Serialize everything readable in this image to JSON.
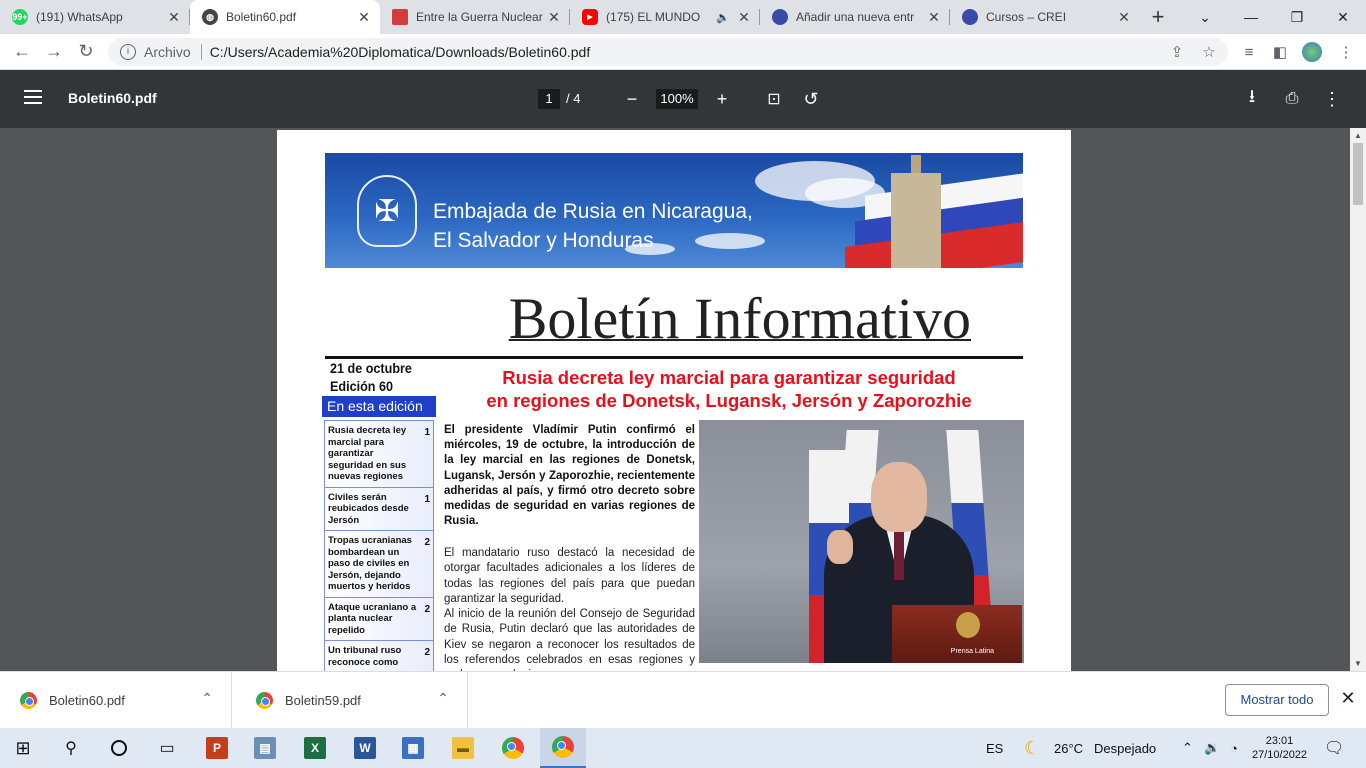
{
  "tabs": [
    {
      "title": "(191) WhatsApp",
      "icon": "whatsapp-icon",
      "icon_color": "#25d366",
      "badge": "99+"
    },
    {
      "title": "Boletin60.pdf",
      "icon": "globe-icon",
      "icon_color": "#444444",
      "active": true
    },
    {
      "title": "Entre la Guerra Nuclear",
      "icon": "site-icon",
      "icon_color": "#d23c3c"
    },
    {
      "title": "(175) EL MUNDO",
      "icon": "youtube-icon",
      "icon_color": "#ff0000"
    },
    {
      "title": "Añadir una nueva entr",
      "icon": "site-icon",
      "icon_color": "#3a4aa8"
    },
    {
      "title": "Cursos – CREI",
      "icon": "site-icon",
      "icon_color": "#3a4aa8"
    }
  ],
  "address": {
    "label": "Archivo",
    "url": "C:/Users/Academia%20Diplomatica/Downloads/Boletin60.pdf"
  },
  "pdf_toolbar": {
    "filename": "Boletin60.pdf",
    "page": "1",
    "page_total": "/ 4",
    "zoom": "100%"
  },
  "pdf": {
    "banner_line1": "Embajada de Rusia en Nicaragua,",
    "banner_line2": "El Salvador y Honduras",
    "title": "Boletín Informativo",
    "date": "21 de octubre",
    "edition": "Edición 60",
    "in_edition": "En esta edición",
    "toc": [
      {
        "text": "Rusia decreta ley marcial para garantizar seguridad en sus nuevas regiones",
        "page": "1"
      },
      {
        "text": "Civiles serán reubicados desde Jersón",
        "page": "1"
      },
      {
        "text": "Tropas ucranianas bombardean un paso de civiles en Jersón, dejando muertos y heridos",
        "page": "2"
      },
      {
        "text": "Ataque ucraniano a planta nuclear repelido",
        "page": "2"
      },
      {
        "text": "Un tribunal ruso reconoce como",
        "page": "2"
      }
    ],
    "headline_line1": "Rusia decreta ley marcial para garantizar seguridad",
    "headline_line2": "en regiones de Donetsk, Lugansk, Jersón y Zaporozhie",
    "lead": "El presidente Vladímir Putin confirmó el miércoles, 19 de octubre, la introducción de la ley marcial en las regiones de Donetsk, Lugansk, Jersón y Zaporozhie, recientemente adheridas al país, y firmó otro decreto sobre medidas de seguridad en varias regiones de Rusia.",
    "para1": "El mandatario ruso destacó la necesidad de otorgar facultades adicionales a los líderes de todas las regiones del país para que puedan garantizar la seguridad.",
    "para2": "Al inicio de la reunión del Consejo de Seguridad de Rusia, Putin declaró que las autoridades de Kiev se negaron a reconocer los resultados de los referendos celebrados en esas regiones y rechazan cualquier",
    "photo_caption": "Prensa Latina"
  },
  "downloads": {
    "items": [
      "Boletin60.pdf",
      "Boletin59.pdf"
    ],
    "show_all": "Mostrar todo"
  },
  "taskbar": {
    "lang": "ES",
    "temp": "26°C",
    "weather": "Despejado",
    "time": "23:01",
    "date": "27/10/2022"
  }
}
